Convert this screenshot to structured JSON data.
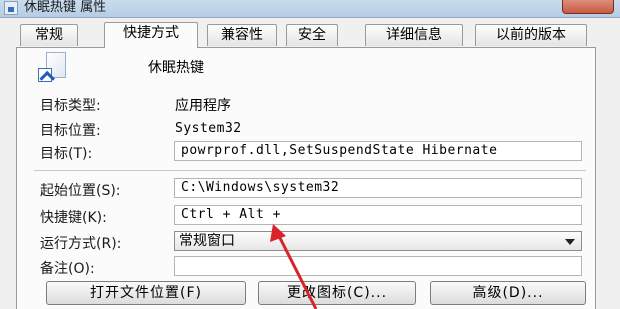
{
  "window": {
    "title": "休眠热键 属性"
  },
  "tabs": [
    {
      "label": "常规"
    },
    {
      "label": "快捷方式"
    },
    {
      "label": "兼容性"
    },
    {
      "label": "安全"
    },
    {
      "label": "详细信息"
    },
    {
      "label": "以前的版本"
    }
  ],
  "shortcut": {
    "name": "休眠热键",
    "target_type_label": "目标类型:",
    "target_type_value": "应用程序",
    "target_location_label": "目标位置:",
    "target_location_value": "System32",
    "target_label": "目标(T):",
    "target_value": "powrprof.dll,SetSuspendState Hibernate",
    "start_in_label": "起始位置(S):",
    "start_in_value": "C:\\Windows\\system32",
    "hotkey_label": "快捷键(K):",
    "hotkey_value": "Ctrl + Alt +",
    "run_label": "运行方式(R):",
    "run_value": "常规窗口",
    "comment_label": "备注(O):",
    "comment_value": ""
  },
  "buttons": {
    "open_location": "打开文件位置(F)",
    "change_icon": "更改图标(C)...",
    "advanced": "高级(D)..."
  },
  "colors": {
    "annotation_arrow": "#d8232a"
  },
  "icons": {
    "title": "shortcut-file-icon",
    "file": "shortcut-file-icon"
  }
}
